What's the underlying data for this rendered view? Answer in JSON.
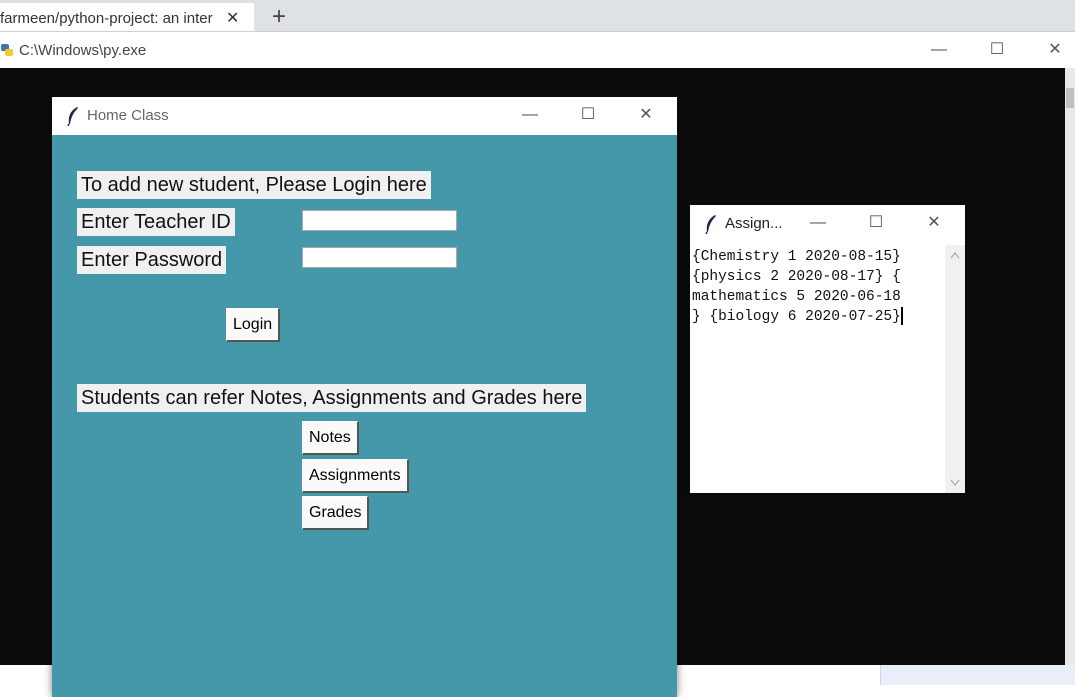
{
  "browser": {
    "tab_title": "farmeen/python-project: an inter",
    "tab_close": "✕",
    "new_tab": "+"
  },
  "console": {
    "title": "C:\\Windows\\py.exe",
    "minimize": "—",
    "maximize": "☐",
    "close": "✕"
  },
  "home_window": {
    "title": "Home Class",
    "minimize": "—",
    "maximize": "☐",
    "close": "✕",
    "add_student_label": "To add new student, Please Login here",
    "teacher_id_label": "Enter Teacher ID",
    "teacher_id_value": "",
    "password_label": "Enter Password",
    "password_value": "",
    "login_button": "Login",
    "students_label": "Students can refer Notes, Assignments and Grades here",
    "notes_button": "Notes",
    "assignments_button": "Assignments",
    "grades_button": "Grades"
  },
  "assign_window": {
    "title": "Assign...",
    "minimize": "—",
    "maximize": "☐",
    "close": "✕",
    "lines": [
      "{Chemistry 1 2020-08-15}",
      "{physics 2 2020-08-17} {",
      "mathematics 5 2020-06-18",
      "} {biology 6 2020-07-25}"
    ]
  },
  "colors": {
    "window_body": "#4498aa",
    "console_background": "#0c0c0c",
    "label_background": "#f0f0f0"
  },
  "icons": {
    "console": "python-icon",
    "home": "feather-icon",
    "assign": "feather-icon"
  }
}
